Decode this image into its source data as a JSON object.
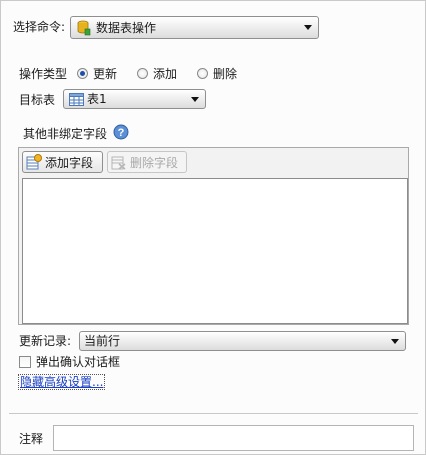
{
  "command": {
    "label": "选择命令:",
    "selected": "数据表操作",
    "icon": "database-cylinder-icon"
  },
  "operation": {
    "label": "操作类型",
    "options": [
      {
        "label": "更新",
        "selected": true
      },
      {
        "label": "添加",
        "selected": false
      },
      {
        "label": "删除",
        "selected": false
      }
    ]
  },
  "target": {
    "label": "目标表",
    "selected": "表1",
    "icon": "table-grid-icon"
  },
  "fields": {
    "label": "其他非绑定字段",
    "help_icon": "question-help-icon",
    "add_button": "添加字段",
    "delete_button": "删除字段"
  },
  "update_record": {
    "label": "更新记录:",
    "selected": "当前行"
  },
  "confirm_dialog": {
    "label": "弹出确认对话框",
    "checked": false
  },
  "advanced_link": "隐藏高级设置...",
  "note": {
    "label": "注释",
    "value": ""
  }
}
